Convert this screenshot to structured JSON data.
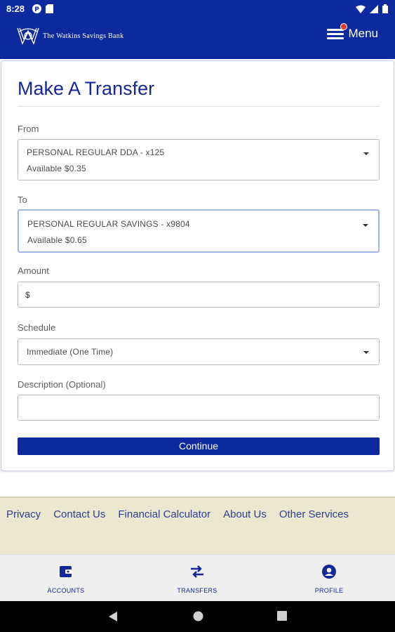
{
  "status_bar": {
    "time": "8:28"
  },
  "header": {
    "bank_name": "The Watkins Savings Bank",
    "menu_label": "Menu"
  },
  "transfer_form": {
    "title": "Make A Transfer",
    "from": {
      "label": "From",
      "account": "PERSONAL REGULAR DDA - x125",
      "available": "Available  $0.35"
    },
    "to": {
      "label": "To",
      "account": "PERSONAL REGULAR SAVINGS - x9804",
      "available": "Available  $0.65"
    },
    "amount": {
      "label": "Amount",
      "prefix": "$",
      "value": ""
    },
    "schedule": {
      "label": "Schedule",
      "selected": "Immediate (One Time)"
    },
    "description": {
      "label": "Description (Optional)",
      "value": ""
    },
    "continue_label": "Continue"
  },
  "footer": {
    "links": [
      "Privacy",
      "Contact Us",
      "Financial Calculator",
      "About Us",
      "Other Services"
    ]
  },
  "bottom_nav": {
    "items": [
      {
        "label": "ACCOUNTS",
        "icon": "wallet-icon"
      },
      {
        "label": "TRANSFERS",
        "icon": "transfer-arrows-icon"
      },
      {
        "label": "PROFILE",
        "icon": "profile-icon"
      }
    ]
  },
  "colors": {
    "brand_blue": "#0c2a9e",
    "footer_bg": "#ece7cf",
    "notification_dot": "#e53935"
  }
}
